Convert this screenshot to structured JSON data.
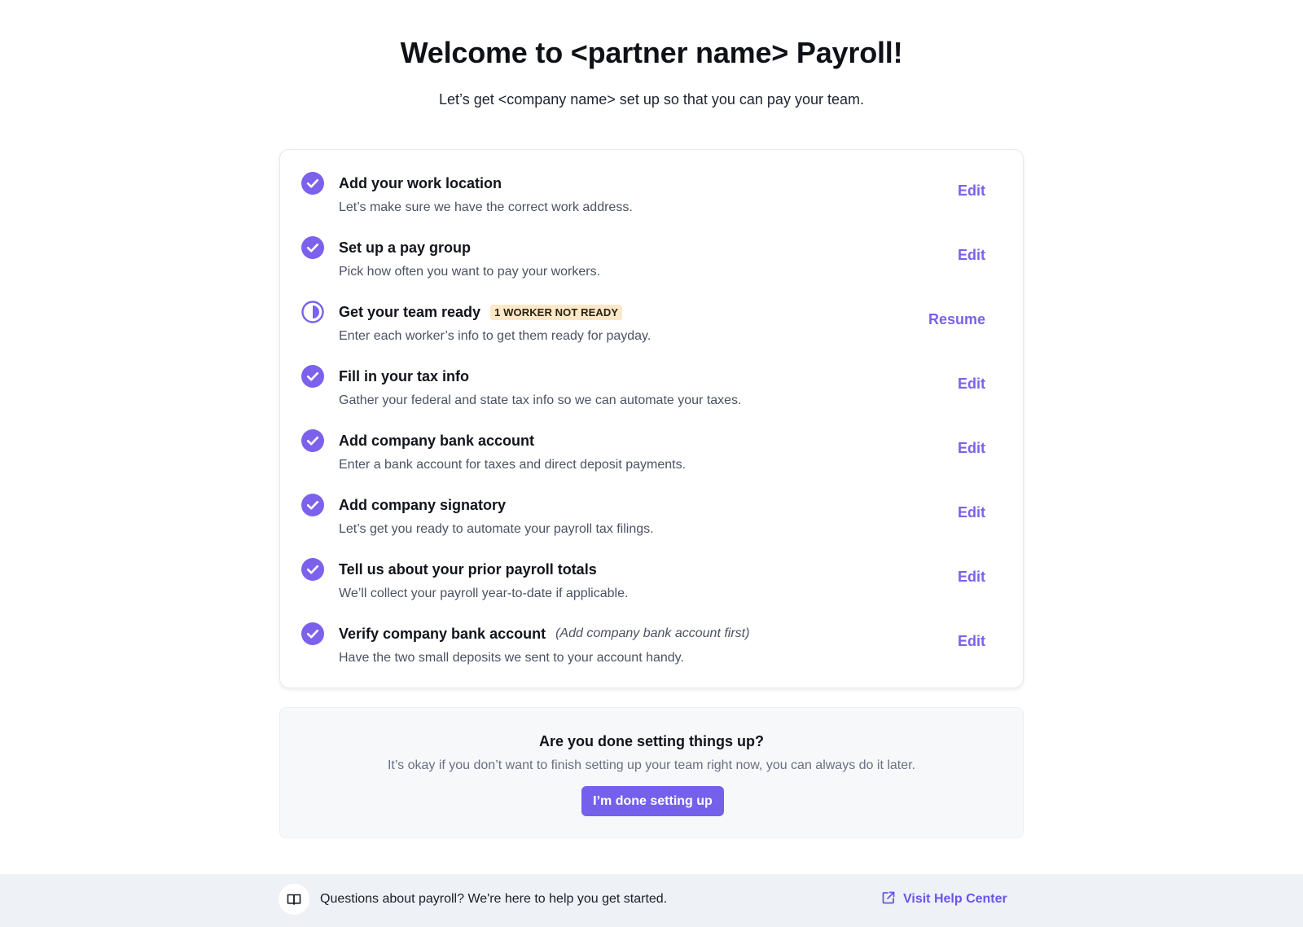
{
  "header": {
    "title": "Welcome to <partner name> Payroll!",
    "subtitle": "Let’s get <company name> set up so that you can pay your team."
  },
  "accent_color": "#7B61EC",
  "steps": [
    {
      "name": "Add your work location",
      "description": "Let’s make sure we have the correct work address.",
      "status": "complete",
      "status_icon": "check-circle-icon",
      "action": "Edit"
    },
    {
      "name": "Set up a pay group",
      "description": "Pick how often you want to pay your workers.",
      "status": "complete",
      "status_icon": "check-circle-icon",
      "action": "Edit"
    },
    {
      "name": "Get your team ready",
      "badge": "1 WORKER NOT READY",
      "description": "Enter each worker’s info to get them ready for payday.",
      "status": "in-progress",
      "status_icon": "half-circle-icon",
      "action": "Resume"
    },
    {
      "name": "Fill in your tax info",
      "description": "Gather your federal and state tax info so we can automate your taxes.",
      "status": "complete",
      "status_icon": "check-circle-icon",
      "action": "Edit"
    },
    {
      "name": "Add company bank account",
      "description": "Enter a bank account for taxes and direct deposit payments.",
      "status": "complete",
      "status_icon": "check-circle-icon",
      "action": "Edit"
    },
    {
      "name": "Add company signatory",
      "description": "Let’s get you ready to automate your payroll tax filings.",
      "status": "complete",
      "status_icon": "check-circle-icon",
      "action": "Edit"
    },
    {
      "name": "Tell us about your prior payroll totals",
      "description": "We’ll collect your payroll year-to-date if applicable.",
      "status": "complete",
      "status_icon": "check-circle-icon",
      "action": "Edit"
    },
    {
      "name": "Verify company bank account",
      "note": "(Add company bank account first)",
      "description": "Have the two small deposits we sent to your account handy.",
      "status": "complete",
      "status_icon": "check-circle-icon",
      "action": "Edit"
    }
  ],
  "done_panel": {
    "title": "Are you done setting things up?",
    "description": "It’s okay if you don’t want to finish setting up your team right now, you can always do it later.",
    "button_label": "I’m done setting up"
  },
  "footer": {
    "icon": "book-icon",
    "help_text": "Questions about payroll? We're here to help you get started.",
    "link_icon": "external-link-icon",
    "link_label": "Visit Help Center"
  }
}
